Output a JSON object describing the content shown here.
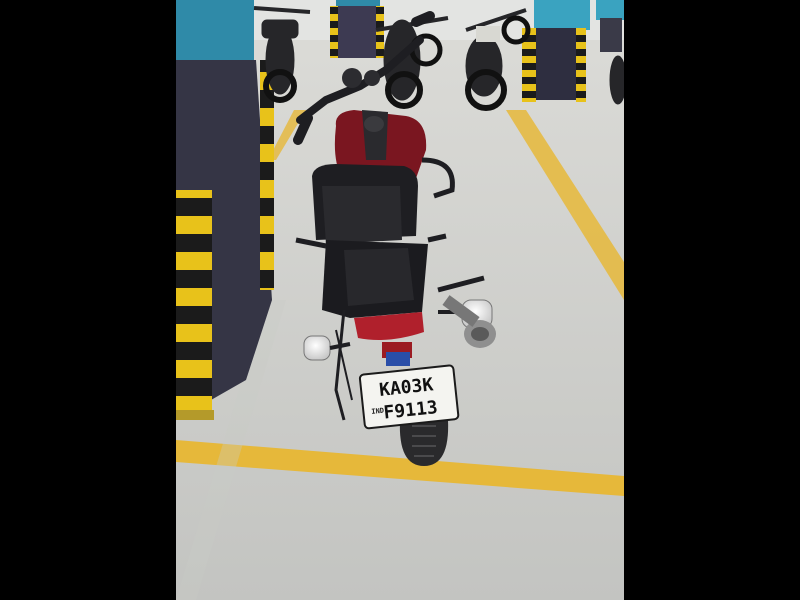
{
  "scene": {
    "colors": {
      "letterbox": "#000000",
      "floor": "#cdcecb",
      "parking_line": "#e6b83a",
      "pillar_blue": "#2f8aa8",
      "pillar_pad": "#3a3a48",
      "hazard_yellow": "#e8c21a",
      "hazard_black": "#1b1b1b",
      "bike_body": "#7a1620",
      "bike_dark": "#1e1e22"
    },
    "number_plate": {
      "line1": "KA03K",
      "line2": "F9113",
      "country_code": "IND"
    }
  }
}
